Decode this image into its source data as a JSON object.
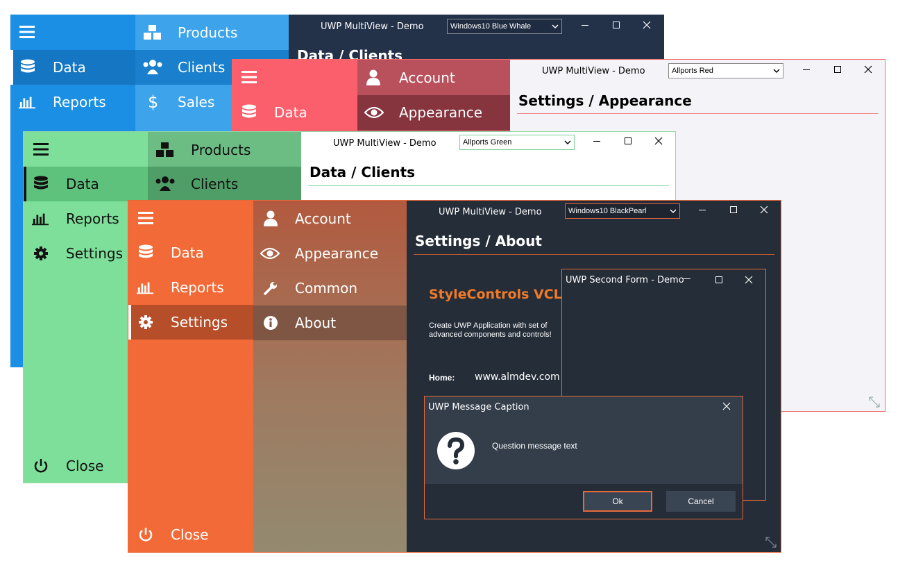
{
  "win_blue": {
    "title": "UWP MultiView - Demo",
    "theme_select": "Windows10 Blue Whale",
    "breadcrumb": "Data / Clients",
    "menu": [
      "Data",
      "Reports"
    ],
    "submenu": [
      "Products",
      "Clients",
      "Sales"
    ]
  },
  "win_red": {
    "title": "UWP MultiView - Demo",
    "theme_select": "Allports Red",
    "breadcrumb": "Settings / Appearance",
    "menu": [
      "Data"
    ],
    "submenu": [
      "Account",
      "Appearance"
    ]
  },
  "win_green": {
    "title": "UWP MultiView - Demo",
    "theme_select": "Allports Green",
    "breadcrumb": "Data / Clients",
    "menu": [
      "Data",
      "Reports",
      "Settings"
    ],
    "submenu": [
      "Products",
      "Clients"
    ],
    "close_label": "Close"
  },
  "win_orange": {
    "title": "UWP MultiView - Demo",
    "theme_select": "Windows10 BlackPearl",
    "breadcrumb": "Settings / About",
    "menu": [
      "Data",
      "Reports",
      "Settings"
    ],
    "submenu": [
      "Account",
      "Appearance",
      "Common",
      "About"
    ],
    "close_label": "Close",
    "about": {
      "product": "StyleControls VCL",
      "description_line1": "Create UWP Application with set of",
      "description_line2": "advanced components and controls!",
      "home_label": "Home:",
      "home_url": "www.almdev.com"
    }
  },
  "second_form": {
    "title": "UWP Second Form - Demo"
  },
  "message_box": {
    "caption": "UWP Message Caption",
    "text": "Question message text",
    "ok_label": "Ok",
    "cancel_label": "Cancel"
  },
  "colors": {
    "blue_theme": "#1a8fe3",
    "red_theme": "#fa5f6b",
    "green_theme": "#7ddf9a",
    "orange_theme": "#f26a37",
    "dark_content": "#242d38",
    "accent_orange": "#f07a28"
  }
}
